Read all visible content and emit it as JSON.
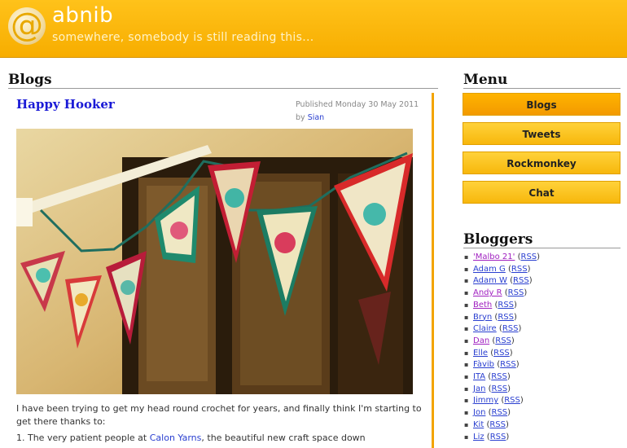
{
  "header": {
    "logo_glyph": "@",
    "title": "abnib",
    "tagline": "somewhere, somebody is still reading this..."
  },
  "main": {
    "section_title": "Blogs",
    "post": {
      "title": "Happy Hooker",
      "meta_prefix": "Published Monday 30 May 2011 by ",
      "author": "Sian",
      "image_alt": "crochet bunting",
      "para1": "I have been trying to get my head round crochet for years, and finally think I'm starting to get there thanks to:",
      "para2_prefix": "1. The very patient people at ",
      "para2_link": "Calon Yarns",
      "para2_suffix": ", the beautiful new craft space down"
    }
  },
  "sidebar": {
    "menu_title": "Menu",
    "menu": [
      {
        "label": "Blogs"
      },
      {
        "label": "Tweets"
      },
      {
        "label": "Rockmonkey"
      },
      {
        "label": "Chat"
      }
    ],
    "bloggers_title": "Bloggers",
    "rss_label": "RSS",
    "bloggers": [
      {
        "name": "'Malbo 21'",
        "visited": true
      },
      {
        "name": "Adam G",
        "visited": false
      },
      {
        "name": "Adam W",
        "visited": false
      },
      {
        "name": "Andy R",
        "visited": true
      },
      {
        "name": "Beth",
        "visited": true
      },
      {
        "name": "Bryn",
        "visited": false
      },
      {
        "name": "Claire",
        "visited": false
      },
      {
        "name": "Dan",
        "visited": true
      },
      {
        "name": "Elle",
        "visited": false
      },
      {
        "name": "Fàvib",
        "visited": false
      },
      {
        "name": "ITA",
        "visited": false
      },
      {
        "name": "Jan",
        "visited": false
      },
      {
        "name": "Jimmy",
        "visited": false
      },
      {
        "name": "Jon",
        "visited": false
      },
      {
        "name": "Kit",
        "visited": false
      },
      {
        "name": "Liz",
        "visited": false
      }
    ]
  },
  "colors": {
    "header_orange": "#f7ad00",
    "menu_button": "#ffc61f",
    "link_blue": "#2a3fd0",
    "visited_purple": "#a020c0"
  }
}
